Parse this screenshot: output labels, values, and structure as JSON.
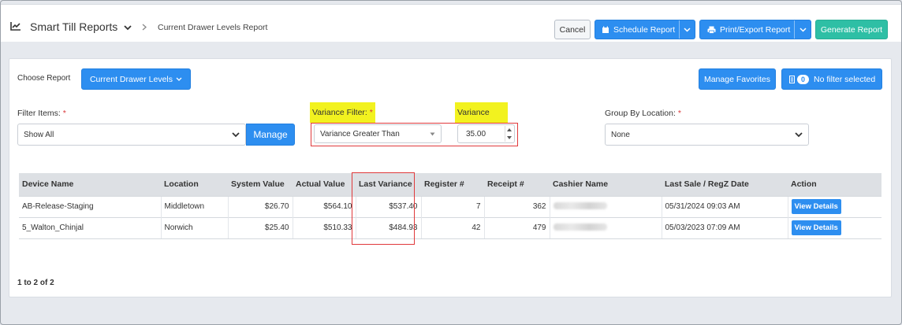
{
  "header": {
    "title": "Smart Till Reports",
    "breadcrumb_current": "Current Drawer Levels Report",
    "cancel_label": "Cancel",
    "schedule_label": "Schedule Report",
    "print_label": "Print/Export Report",
    "generate_label": "Generate Report"
  },
  "choose": {
    "label": "Choose Report",
    "selected": "Current Drawer Levels",
    "manage_favorites": "Manage Favorites",
    "filter_count": "0",
    "filter_status": "No filter selected"
  },
  "filters": {
    "filter_items_label": "Filter Items:",
    "filter_items_value": "Show All",
    "manage_label": "Manage",
    "variance_filter_label": "Variance Filter:",
    "variance_filter_value": "Variance Greater Than",
    "variance_label": "Variance",
    "variance_value": "35.00",
    "group_by_label": "Group By Location:",
    "group_by_value": "None",
    "required_mark": "*"
  },
  "table": {
    "columns": [
      "Device Name",
      "Location",
      "System Value",
      "Actual Value",
      "Last Variance",
      "Register #",
      "Receipt #",
      "Cashier Name",
      "Last Sale / RegZ Date",
      "Action"
    ],
    "rows": [
      {
        "device": "AB-Release-Staging",
        "location": "Middletown",
        "system": "$26.70",
        "actual": "$564.10",
        "variance": "$537.40",
        "register": "7",
        "receipt": "362",
        "date": "05/31/2024 09:03 AM",
        "action": "View Details"
      },
      {
        "device": "5_Walton_Chinjal",
        "location": "Norwich",
        "system": "$25.40",
        "actual": "$510.33",
        "variance": "$484.93",
        "register": "42",
        "receipt": "479",
        "date": "05/03/2023 07:09 AM",
        "action": "View Details"
      }
    ]
  },
  "pagination": {
    "text": "1 to 2 of 2"
  },
  "colors": {
    "primary": "#2d8ef0",
    "teal": "#2ebfa5",
    "highlight": "#f2f21f",
    "callout": "#e0393b"
  }
}
